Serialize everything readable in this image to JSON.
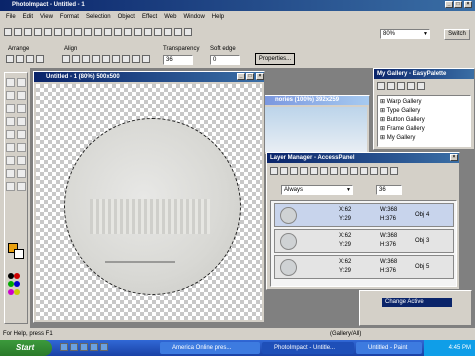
{
  "app": {
    "title": "PhotoImpact - Untitled - 1",
    "switch": "Switch"
  },
  "menu": [
    "File",
    "Edit",
    "View",
    "Format",
    "Selection",
    "Object",
    "Effect",
    "Web",
    "Window",
    "Help"
  ],
  "zoom": "80%",
  "toolbar2": {
    "arrange": "Arrange",
    "align": "Align",
    "transparency": "Transparency",
    "transparency_value": "36",
    "soft_edge": "Soft edge",
    "soft_edge_value": "0",
    "properties": "Properties..."
  },
  "doc1": {
    "title": "Untitled - 1 (80%) 500x500"
  },
  "doc2": {
    "title": "nories (100%) 392x259"
  },
  "gallery": {
    "title": "My Gallery - EasyPalette",
    "items": [
      "Warp Gallery",
      "Type Gallery",
      "Button Gallery",
      "Frame Gallery",
      "My Gallery"
    ]
  },
  "layers": {
    "title": "Layer Manager - AccessPanel",
    "mode": "Always",
    "value": "36",
    "rows": [
      {
        "x": "X:62",
        "y": "Y:29",
        "w": "W:368",
        "h": "H:376",
        "obj": "Obj 4"
      },
      {
        "x": "X:62",
        "y": "Y:29",
        "w": "W:368",
        "h": "H:376",
        "obj": "Obj 3"
      },
      {
        "x": "X:62",
        "y": "Y:29",
        "w": "W:368",
        "h": "H:376",
        "obj": "Obj 5"
      }
    ]
  },
  "history": {
    "item": "Change Active"
  },
  "status": {
    "left": "For Help, press F1",
    "right": "(Gallery/All)"
  },
  "taskbar": {
    "start": "Start",
    "tasks": [
      "America Online pres...",
      "PhotoImpact - Untitle...",
      "Untitled - Paint"
    ],
    "time": "4:45 PM"
  }
}
